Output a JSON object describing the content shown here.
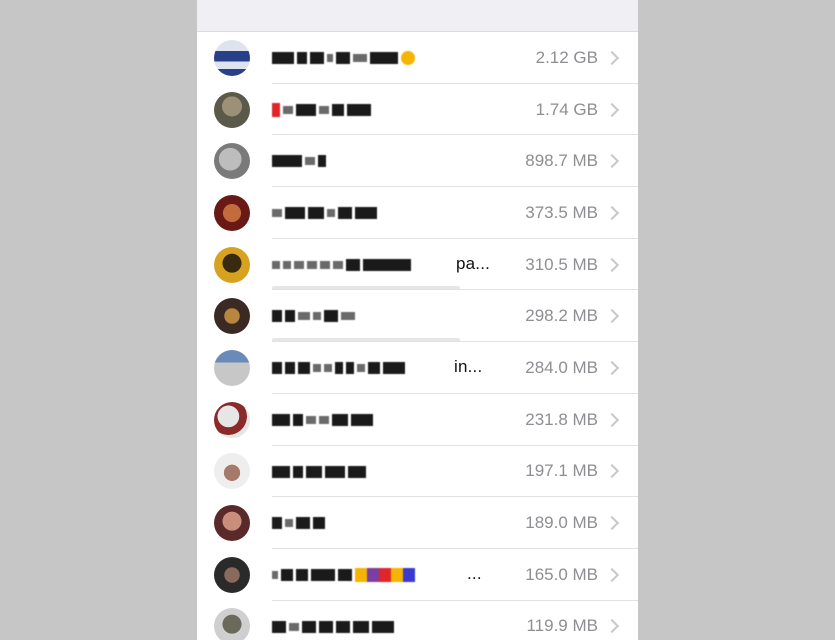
{
  "storage_list": {
    "items": [
      {
        "size": "2.12 GB",
        "suffix": "",
        "avatar_colors": [
          "#2a3f8a",
          "#dfe3ee"
        ]
      },
      {
        "size": "1.74 GB",
        "suffix": "",
        "avatar_colors": [
          "#5b5a4a",
          "#9d9078"
        ]
      },
      {
        "size": "898.7 MB",
        "suffix": "",
        "avatar_colors": [
          "#7a7a7a",
          "#bdbdbd"
        ]
      },
      {
        "size": "373.5 MB",
        "suffix": "",
        "avatar_colors": [
          "#6a1a16",
          "#c46b3d"
        ]
      },
      {
        "size": "310.5 MB",
        "suffix": "pa...",
        "avatar_colors": [
          "#3a2a10",
          "#d6a21f"
        ]
      },
      {
        "size": "298.2 MB",
        "suffix": "",
        "avatar_colors": [
          "#3b2a24",
          "#b8863f"
        ]
      },
      {
        "size": "284.0 MB",
        "suffix": "in...",
        "avatar_colors": [
          "#6a8ab8",
          "#c7c7c7"
        ]
      },
      {
        "size": "231.8 MB",
        "suffix": "",
        "avatar_colors": [
          "#8a2a2a",
          "#e6e6e6"
        ]
      },
      {
        "size": "197.1 MB",
        "suffix": "",
        "avatar_colors": [
          "#a67a6a",
          "#eeeeee"
        ]
      },
      {
        "size": "189.0 MB",
        "suffix": "",
        "avatar_colors": [
          "#5a2a2a",
          "#c98f7a"
        ]
      },
      {
        "size": "165.0 MB",
        "suffix": "...",
        "avatar_colors": [
          "#2a2a2a",
          "#8a6a5a"
        ]
      },
      {
        "size": "119.9 MB",
        "suffix": "",
        "avatar_colors": [
          "#6a6a5a",
          "#cfcfcf"
        ]
      }
    ]
  }
}
